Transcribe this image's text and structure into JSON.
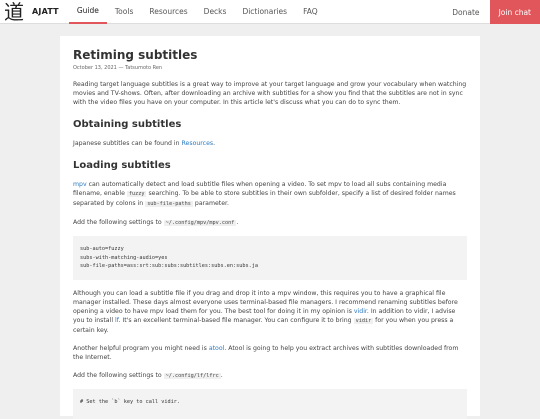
{
  "nav": {
    "logo_glyph": "道",
    "brand": "AJATT",
    "links": [
      "Guide",
      "Tools",
      "Resources",
      "Decks",
      "Dictionaries",
      "FAQ"
    ],
    "donate": "Donate",
    "join": "Join chat"
  },
  "article": {
    "title": "Retiming subtitles",
    "meta": "October 13, 2021 — Tatsumoto Ren",
    "intro": "Reading target language subtitles is a great way to improve at your target language and grow your vocabulary when watching movies and TV-shows. Often, after downloading an archive with subtitles for a show you find that the subtitles are not in sync with the video files you have on your computer. In this article let's discuss what you can do to sync them.",
    "h_obtaining": "Obtaining subtitles",
    "obtain_pre": "Japanese subtitles can be found in ",
    "obtain_link": "Resources",
    "obtain_post": ".",
    "h_loading": "Loading subtitles",
    "p1_link": "mpv",
    "p1_a": " can automatically detect and load subtitle files when opening a video. To set mpv to load all subs containing media filename, enable ",
    "p1_code1": "fuzzy",
    "p1_b": " searching. To be able to store subtitles in their own subfolder, specify a list of desired folder names separated by colons in ",
    "p1_code2": "sub-file-paths",
    "p1_c": " parameter.",
    "p2_a": "Add the following settings to ",
    "p2_code": "~/.config/mpv/mpv.conf",
    "p2_b": ".",
    "code1": [
      "sub-auto=fuzzy",
      "subs-with-matching-audio=yes",
      "sub-file-paths=ass:srt:sub:subs:subtitles:subs.en:subs.ja"
    ],
    "p3_a": "Although you can load a subtitle file if you drag and drop it into a mpv window, this requires you to have a graphical file manager installed. These days almost everyone uses terminal-based file managers. I recommend renaming subtitles before opening a video to have mpv load them for you. The best tool for doing it in my opinion is ",
    "p3_link1": "vidir",
    "p3_b": ". In addition to vidir, I advise you to install ",
    "p3_link2": "lf",
    "p3_c": ". It's an excellent terminal-based file manager. You can configure it to bring ",
    "p3_code": "vidir",
    "p3_d": " for you when you press a certain key.",
    "p4_a": "Another helpful program you might need is ",
    "p4_link": "atool",
    "p4_b": ". Atool is going to help you extract archives with subtitles downloaded from the Internet.",
    "p5_a": "Add the following settings to ",
    "p5_code": "~/.config/lf/lfrc",
    "p5_b": ".",
    "code2": [
      "# Set the `b` key to call vidir."
    ]
  },
  "colors": {
    "accent": "#e0565b",
    "link": "#2a79c1",
    "background": "#efefef"
  }
}
